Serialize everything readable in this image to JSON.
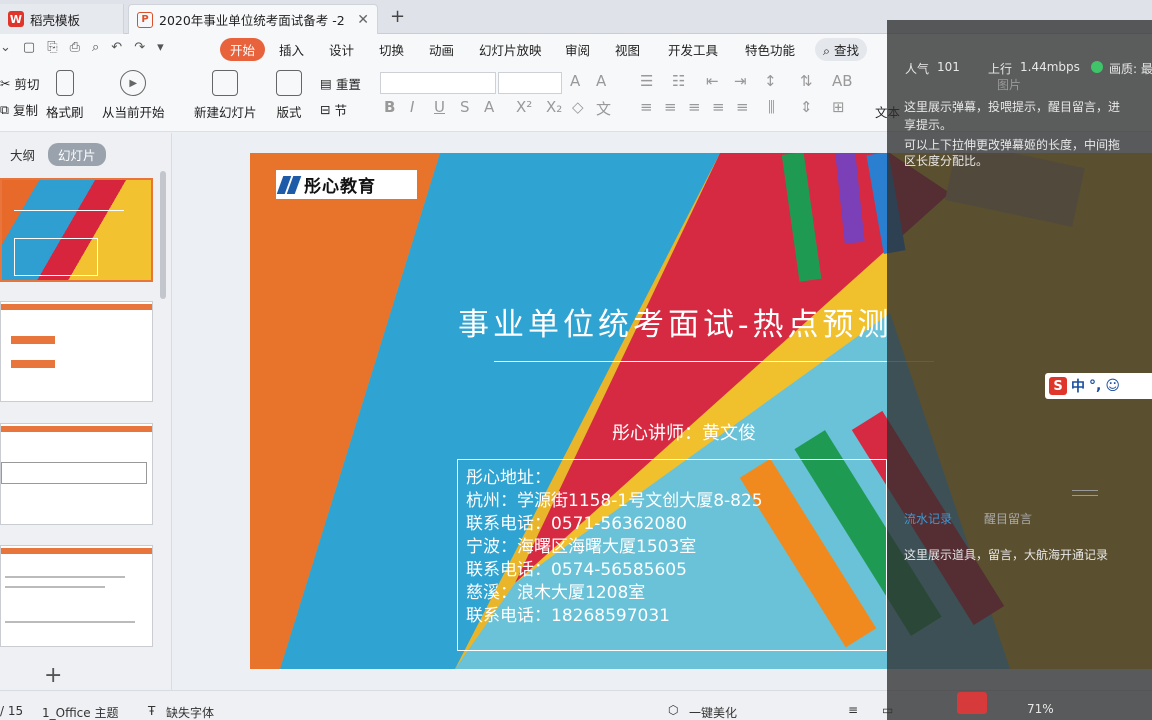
{
  "tabs": [
    {
      "label": "稻壳模板"
    },
    {
      "label": "2020年事业单位统考面试备考 -2"
    }
  ],
  "menu": {
    "items": [
      "开始",
      "插入",
      "设计",
      "切换",
      "动画",
      "幻灯片放映",
      "审阅",
      "视图",
      "开发工具",
      "特色功能"
    ],
    "search": "查找"
  },
  "ribbon": {
    "cut": "剪切",
    "copy": "复制",
    "format_painter": "格式刷",
    "play_from_current": "从当前开始",
    "new_slide": "新建幻灯片",
    "layout": "版式",
    "section": "节",
    "reset": "重置",
    "text_partial": "文本"
  },
  "panel": {
    "outline_tab": "大纲",
    "slides_tab": "幻灯片",
    "add_button": "+"
  },
  "slide": {
    "logo": "彤心教育",
    "title": "事业单位统考面试-热点预测",
    "lecturer": "彤心讲师：黄文俊",
    "address_lines": [
      "彤心地址：",
      "杭州：学源街1158-1号文创大厦8-825",
      "联系电话：0571-56362080",
      "宁波：海曙区海曙大厦1503室",
      "联系电话：0574-56585605",
      "慈溪：浪木大厦1208室",
      "联系电话：18268597031"
    ]
  },
  "status": {
    "page": "/ 15",
    "theme": "1_Office 主题",
    "missing_font": "缺失字体",
    "beautify": "一键美化",
    "zoom": "71%"
  },
  "overlay": {
    "popularity_label": "人气",
    "popularity_value": "101",
    "upload_label": "上行",
    "upload_value": "1.44mbps",
    "quality": "画质: 最",
    "danmaku_hint_1": "这里展示弹幕，投喂提示，醒目留言，进",
    "danmaku_hint_2": "享提示。",
    "danmaku_hint_3": "可以上下拉伸更改弹幕姬的长度，中间拖",
    "danmaku_hint_4": "区长度分配比。",
    "tab_flow": "流水记录",
    "tab_message": "醒目留言",
    "flow_hint": "这里展示道具，留言，大航海开通记录",
    "ribbon_image": "图片"
  },
  "ime": {
    "lang": "中"
  }
}
